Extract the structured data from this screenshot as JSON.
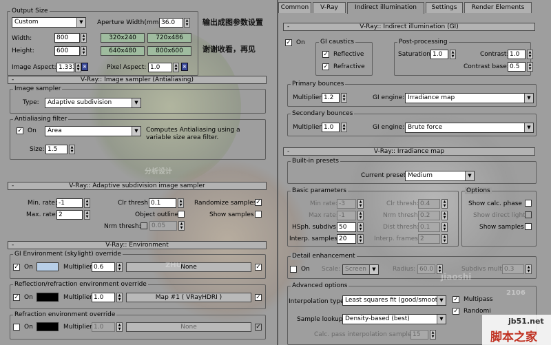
{
  "output": {
    "title": "Output Size",
    "preset": "Custom",
    "aperture_label": "Aperture Width(mm):",
    "aperture_value": "36.0",
    "width_label": "Width:",
    "width_value": "800",
    "height_label": "Height:",
    "height_value": "600",
    "res1": "320x240",
    "res2": "720x486",
    "res3": "640x480",
    "res4": "800x600",
    "aspect_label": "Image Aspect:",
    "aspect_value": "1.333",
    "pixel_aspect_label": "Pixel Aspect:",
    "pixel_aspect_value": "1.0"
  },
  "notes": {
    "line1": "输出成图参数设置",
    "line2": "谢谢收看，再见"
  },
  "left": {
    "sampler": {
      "rollout": "V-Ray:: Image sampler (Antialiasing)",
      "group": "Image sampler",
      "type_label": "Type:",
      "type_value": "Adaptive subdivision",
      "aa_group": "Antialiasing filter",
      "aa_on": "On",
      "aa_value": "Area",
      "aa_desc": "Computes Antialiasing using a variable size area filter.",
      "size_label": "Size:",
      "size_value": "1.5"
    },
    "adaptive": {
      "rollout": "V-Ray:: Adaptive subdivision image sampler",
      "min_label": "Min. rate:",
      "min_value": "-1",
      "max_label": "Max. rate:",
      "max_value": "2",
      "clr_label": "Clr thresh:",
      "clr_value": "0.1",
      "randomize": "Randomize samples",
      "outline": "Object outline",
      "show": "Show samples",
      "nrm_label": "Nrm thresh:",
      "nrm_value": "0.05"
    },
    "env": {
      "rollout": "V-Ray:: Environment",
      "gi_group": "GI Environment (skylight) override",
      "on": "On",
      "mult_label": "Multiplier:",
      "gi_mult": "0.6",
      "gi_map": "None",
      "refl_group": "Reflection/refraction environment override",
      "refl_mult": "1.0",
      "refl_map": "Map #1  ( VRayHDRI )",
      "refr_group": "Refraction environment override",
      "refr_mult": "1.0",
      "refr_map": "None"
    }
  },
  "tabs": [
    "Common",
    "V-Ray",
    "Indirect illumination",
    "Settings",
    "Render Elements"
  ],
  "right": {
    "gi": {
      "rollout": "V-Ray:: Indirect illumination (GI)",
      "on": "On",
      "caustics_group": "GI caustics",
      "reflective": "Reflective",
      "refractive": "Refractive",
      "post_group": "Post-processing",
      "sat_label": "Saturation:",
      "sat_value": "1.0",
      "con_label": "Contrast:",
      "con_value": "1.0",
      "cb_label": "Contrast base:",
      "cb_value": "0.5",
      "primary_group": "Primary bounces",
      "mult_label": "Multiplier:",
      "p_mult": "1.2",
      "engine_label": "GI engine:",
      "p_engine": "Irradiance map",
      "secondary_group": "Secondary bounces",
      "s_mult": "1.0",
      "s_engine": "Brute force"
    },
    "irr": {
      "rollout": "V-Ray:: Irradiance map",
      "presets_group": "Built-in presets",
      "current_label": "Current preset:",
      "current_value": "Medium",
      "basic_group": "Basic parameters",
      "min_label": "Min rate:",
      "min_value": "-3",
      "max_label": "Max rate:",
      "max_value": "-1",
      "hsph_label": "HSph. subdivs:",
      "hsph_value": "50",
      "interp_label": "Interp. samples:",
      "interp_value": "20",
      "clr_label": "Clr thresh:",
      "clr_value": "0.4",
      "nrm_label": "Nrm thresh:",
      "nrm_value": "0.2",
      "dist_label": "Dist thresh:",
      "dist_value": "0.1",
      "frames_label": "Interp. frames:",
      "frames_value": "2",
      "options_group": "Options",
      "show_phase": "Show calc. phase",
      "show_direct": "Show direct light",
      "show_samples": "Show samples",
      "detail_group": "Detail enhancement",
      "on": "On",
      "scale_label": "Scale:",
      "scale_value": "Screen",
      "radius_label": "Radius:",
      "radius_value": "60.0",
      "subdivs_label": "Subdivs mult.",
      "subdivs_value": "0.3",
      "adv_group": "Advanced options",
      "interp_type_label": "Interpolation type:",
      "interp_type_value": "Least squares fit (good/smooth",
      "lookup_label": "Sample lookup:",
      "lookup_value": "Density-based (best)",
      "multipass": "Multipass",
      "randomize": "Randomi",
      "calc_label": "Calc. pass interpolation samples:",
      "calc_value": "15"
    }
  },
  "watermarks": {
    "site": "jb51.net",
    "site_cn": "脚本之家",
    "logo_top": "分析设计",
    "logo_mid": "jiaoshi",
    "logo_bot": "ZHU",
    "numbers": "2106"
  },
  "colors": {
    "bg": "#9e9e9e",
    "rollout": "#b3b3b3",
    "green_button": "#9fbc9f",
    "gi_swatch": "#b8cfe8",
    "refl_swatch": "#000000",
    "refr_swatch": "#000000"
  }
}
